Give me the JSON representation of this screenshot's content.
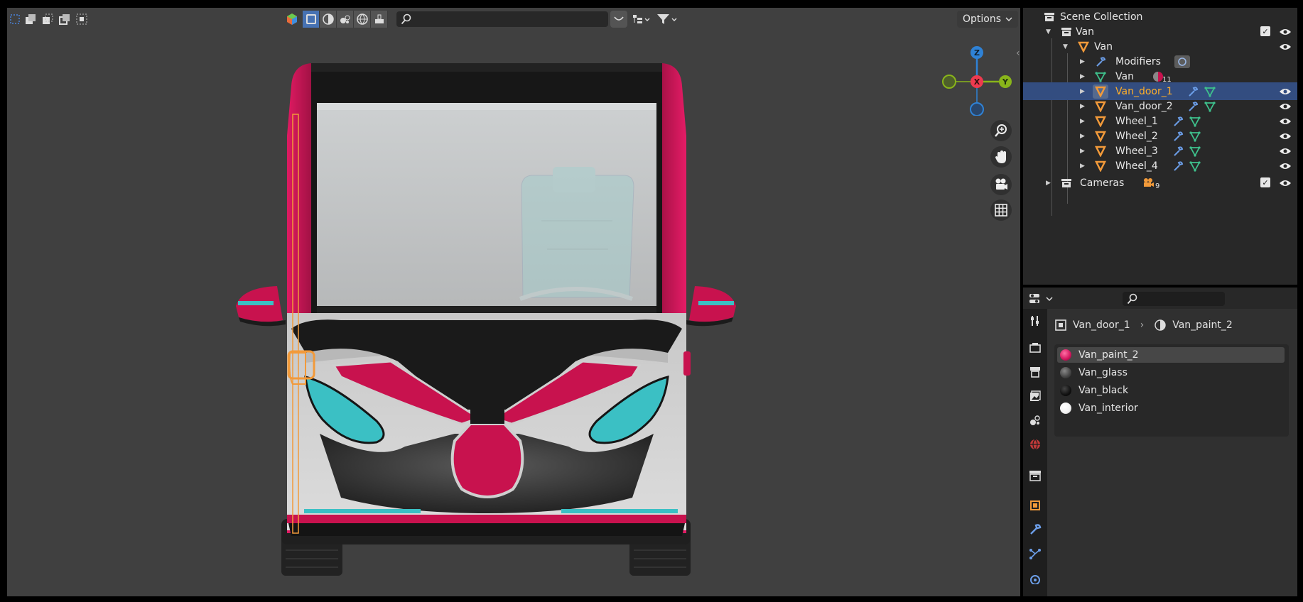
{
  "viewport": {
    "options_label": "Options",
    "search_placeholder": "",
    "gizmo": {
      "z": "Z",
      "x": "X",
      "y": "Y"
    }
  },
  "outliner": {
    "rows": [
      {
        "label": "Scene Collection"
      },
      {
        "label": "Van"
      },
      {
        "label": "Van"
      },
      {
        "label": "Modifiers"
      },
      {
        "label": "Van",
        "badge": "11"
      },
      {
        "label": "Van_door_1"
      },
      {
        "label": "Van_door_2"
      },
      {
        "label": "Wheel_1"
      },
      {
        "label": "Wheel_2"
      },
      {
        "label": "Wheel_3"
      },
      {
        "label": "Wheel_4"
      },
      {
        "label": "Cameras",
        "badge": "9"
      }
    ],
    "selected_color": "#334d80"
  },
  "properties": {
    "breadcrumb": {
      "object": "Van_door_1",
      "material": "Van_paint_2"
    },
    "materials": [
      {
        "name": "Van_paint_2",
        "color": "#d1155d"
      },
      {
        "name": "Van_glass",
        "color": "#555555"
      },
      {
        "name": "Van_black",
        "color": "#111111"
      },
      {
        "name": "Van_interior",
        "color": "#f2f2f2"
      }
    ]
  },
  "colors": {
    "van_pink": "#c8124e",
    "van_teal": "#3bc0c4",
    "accent_blue": "#4772b3",
    "axis_x": "#ee3a4f",
    "axis_y": "#89b51a",
    "axis_z": "#2f82d6"
  }
}
